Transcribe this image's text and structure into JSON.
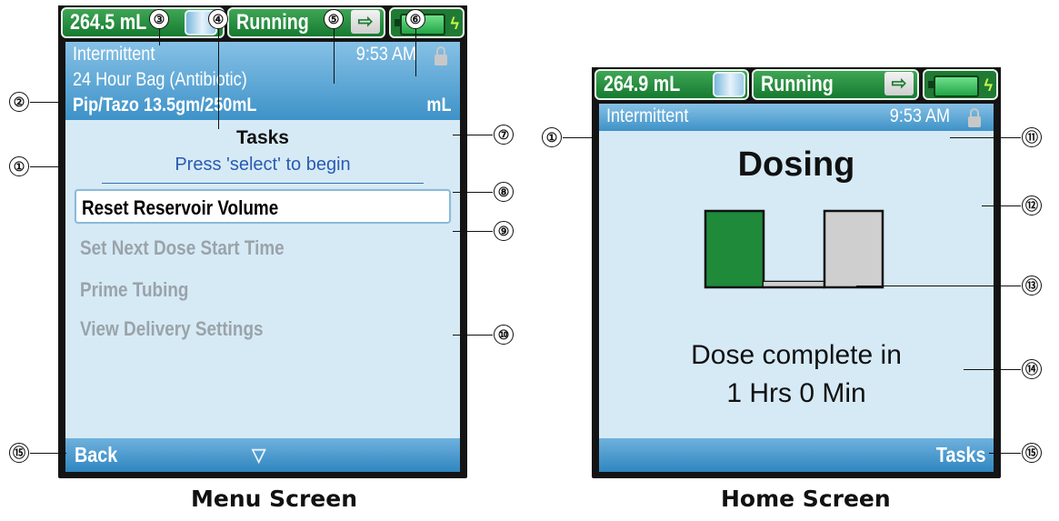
{
  "menu_screen": {
    "caption": "Menu Screen",
    "status": {
      "volume": "264.5 mL",
      "state": "Running"
    },
    "header": {
      "mode": "Intermittent",
      "time": "9:53 AM",
      "bag": "24 Hour Bag (Antibiotic)",
      "drug": "Pip/Tazo 13.5gm/250mL",
      "unit": "mL"
    },
    "tasks_title": "Tasks",
    "tasks_hint": "Press 'select' to begin",
    "menu_items": [
      {
        "label": "Reset Reservoir Volume"
      },
      {
        "label": "Set Next Dose Start Time"
      },
      {
        "label": "Prime Tubing"
      },
      {
        "label": "View Delivery Settings"
      }
    ],
    "softkey_left": "Back",
    "scroll_indicator": "▽"
  },
  "home_screen": {
    "caption": "Home Screen",
    "status": {
      "volume": "264.9 mL",
      "state": "Running"
    },
    "header": {
      "mode": "Intermittent",
      "time": "9:53 AM"
    },
    "dosing_title": "Dosing",
    "dose_line1": "Dose complete in",
    "dose_line2": "1 Hrs 0 Min",
    "softkey_right": "Tasks"
  },
  "callouts": {
    "c1": "①",
    "c2": "②",
    "c3": "③",
    "c4": "④",
    "c5": "⑤",
    "c6": "⑥",
    "c7": "⑦",
    "c8": "⑧",
    "c9": "⑨",
    "c10": "⑩",
    "c11": "⑪",
    "c12": "⑫",
    "c13": "⑬",
    "c14": "⑭",
    "c15": "⑮"
  },
  "colors": {
    "status_green": "#1e8a3a",
    "header_blue": "#4a9bd0",
    "screen_bg": "#d6eaf6",
    "hint_blue": "#2a5bb0"
  },
  "icons": [
    "reservoir-icon",
    "runner-icon",
    "battery-icon",
    "plug-icon",
    "lock-icon",
    "scroll-down-icon"
  ]
}
